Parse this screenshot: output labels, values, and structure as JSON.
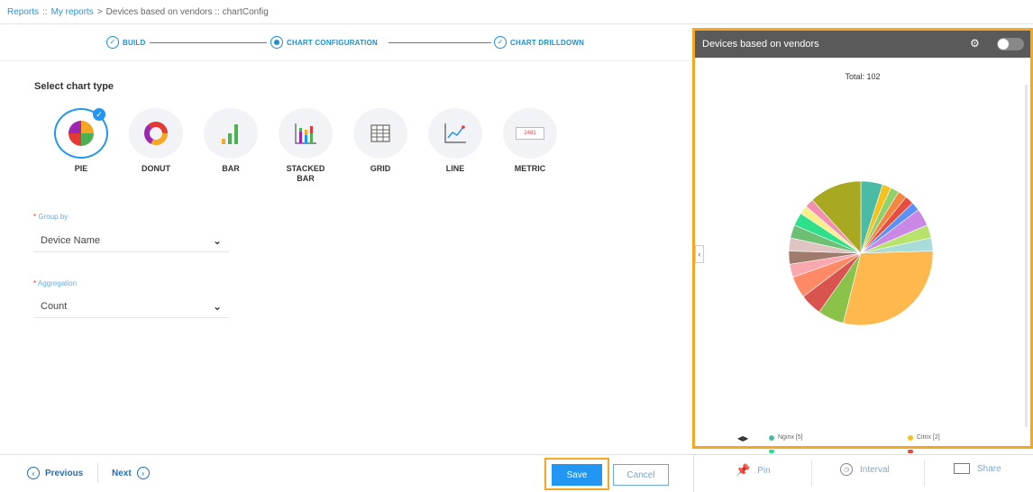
{
  "breadcrumb": {
    "reports": "Reports",
    "sep1": " :: ",
    "my_reports": "My reports",
    "sep2": " > ",
    "current": "Devices based on vendors :: chartConfig"
  },
  "stepper": {
    "steps": [
      {
        "label": "BUILD"
      },
      {
        "label": "CHART CONFIGURATION"
      },
      {
        "label": "CHART DRILLDOWN"
      }
    ]
  },
  "chart_type": {
    "title": "Select chart type",
    "options": [
      {
        "label": "PIE",
        "icon": "pie-chart-icon",
        "selected": true
      },
      {
        "label": "DONUT",
        "icon": "donut-chart-icon"
      },
      {
        "label": "BAR",
        "icon": "bar-chart-icon"
      },
      {
        "label": "STACKED BAR",
        "icon": "stacked-bar-chart-icon"
      },
      {
        "label": "GRID",
        "icon": "grid-table-icon"
      },
      {
        "label": "LINE",
        "icon": "line-chart-icon"
      },
      {
        "label": "METRIC",
        "icon": "metric-icon"
      }
    ],
    "metric_sample": "2481"
  },
  "group_by": {
    "label": "Group by",
    "required": "*",
    "value": "Device Name"
  },
  "aggregation": {
    "label": "Aggregation",
    "required": "*",
    "value": "Count"
  },
  "footer": {
    "previous": "Previous",
    "next": "Next",
    "save": "Save",
    "cancel": "Cancel",
    "pin": "Pin",
    "interval": "Interval",
    "share": "Share"
  },
  "preview": {
    "title": "Devices based on vendors",
    "total": "Total: 102",
    "legend": [
      {
        "label": "Nginx [5]",
        "color": "#4cbba6"
      },
      {
        "label": "Citrix [2]",
        "color": "#f7c11d"
      }
    ],
    "colors": {
      "accent": "#2196f3",
      "highlight": "#f5a623",
      "header": "#5a5a5a"
    }
  },
  "chart_data": {
    "type": "pie",
    "title": "Devices based on vendors",
    "total": 102,
    "slices": [
      {
        "value": 5,
        "color": "#4cbba6"
      },
      {
        "value": 2,
        "color": "#f7c11d"
      },
      {
        "value": 2,
        "color": "#8fd16a"
      },
      {
        "value": 2,
        "color": "#f5853f"
      },
      {
        "value": 2,
        "color": "#e84c3d"
      },
      {
        "value": 2,
        "color": "#5b8ff9"
      },
      {
        "value": 4,
        "color": "#c987e6"
      },
      {
        "value": 3,
        "color": "#b7e36b"
      },
      {
        "value": 3,
        "color": "#a8dcd9"
      },
      {
        "value": 30,
        "color": "#ffb84d"
      },
      {
        "value": 6,
        "color": "#8bc34a"
      },
      {
        "value": 5,
        "color": "#d9534f"
      },
      {
        "value": 5,
        "color": "#ff8a65"
      },
      {
        "value": 3,
        "color": "#f9a8b0"
      },
      {
        "value": 3,
        "color": "#9e7b6a"
      },
      {
        "value": 3,
        "color": "#e0c3c3"
      },
      {
        "value": 3,
        "color": "#6dbf74"
      },
      {
        "value": 3,
        "color": "#2ee08a"
      },
      {
        "value": 2,
        "color": "#f6ef8a"
      },
      {
        "value": 2,
        "color": "#f48fb1"
      },
      {
        "value": 12,
        "color": "#a8a821"
      }
    ]
  }
}
